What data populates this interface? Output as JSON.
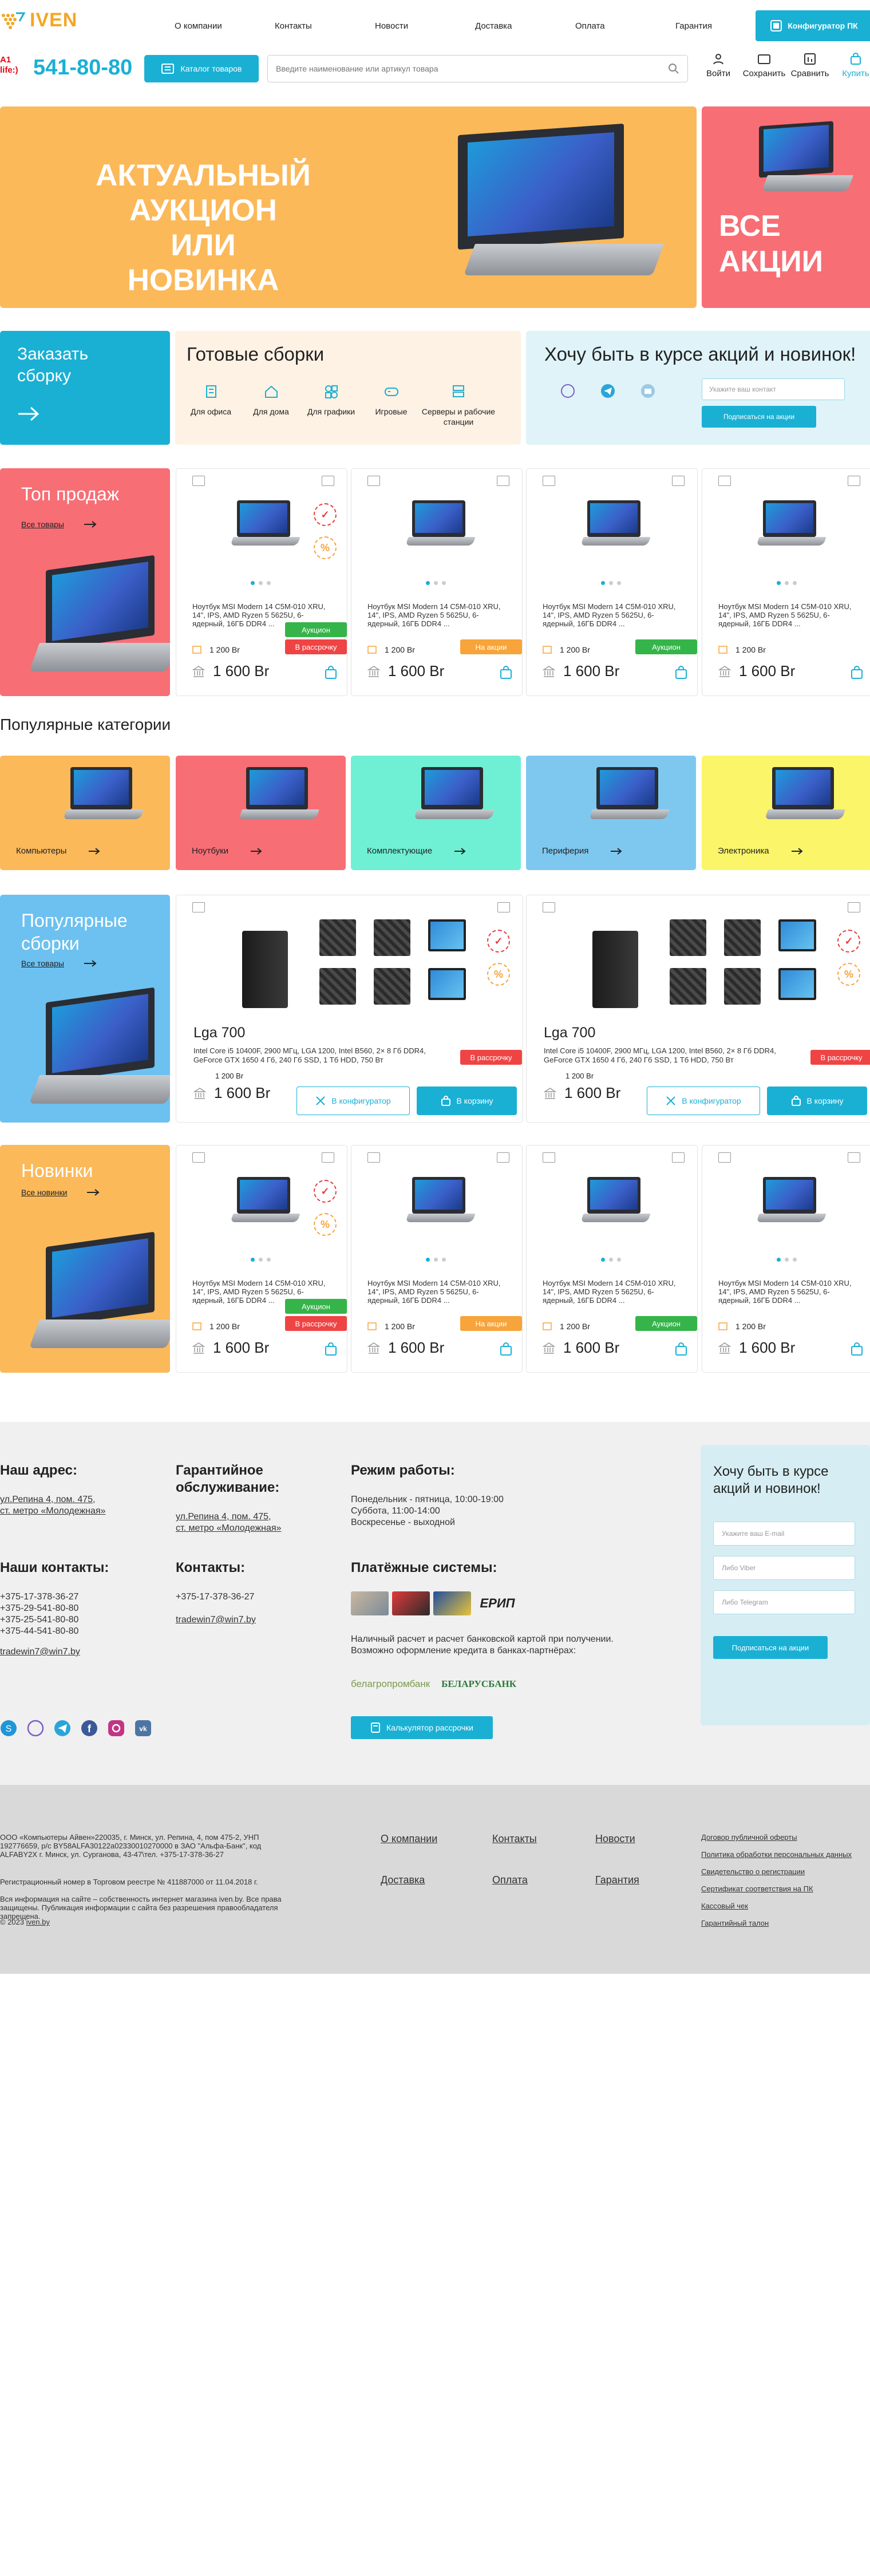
{
  "header": {
    "logo_text": "IVEN",
    "nav": [
      "О компании",
      "Контакты",
      "Новости",
      "Доставка",
      "Оплата",
      "Гарантия"
    ],
    "configurator_label": "Конфигуратор ПК",
    "phone_logo": "A1 life:)",
    "phone": "541-80-80",
    "catalog_label": "Каталог товаров",
    "search_placeholder": "Введите наименование или артикул товара",
    "icons": {
      "login": "Войти",
      "save": "Сохранить",
      "compare": "Сравнить",
      "buy": "Купить"
    }
  },
  "banner": {
    "main_lines": [
      "АКТУАЛЬНЫЙ АУКЦИОН",
      "ИЛИ",
      "НОВИНКА"
    ],
    "side_lines": [
      "ВСЕ",
      "АКЦИИ"
    ]
  },
  "order": {
    "title_lines": [
      "Заказать",
      "сборку"
    ]
  },
  "ready": {
    "title": "Готовые сборки",
    "items": [
      "Для офиса",
      "Для дома",
      "Для графики",
      "Игровые",
      "Серверы и рабочие станции"
    ]
  },
  "subscribe": {
    "title": "Хочу быть в курсе акций и новинок!",
    "placeholder": "Укажите ваш контакт",
    "button": "Подписаться на акции"
  },
  "top_sales": {
    "title": "Топ продаж",
    "link": "Все товары",
    "desc": "Ноутбук MSI Modern 14 C5M-010 XRU, 14\", IPS, AMD Ryzen 5 5625U, 6-ядерный, 16ГБ DDR4 ...",
    "products": [
      {
        "badges": [
          "Аукцион",
          "В рассрочку"
        ],
        "old": "1 200 Br",
        "price": "1 600 Br"
      },
      {
        "badges": [
          "На акции"
        ],
        "old": "1 200 Br",
        "price": "1 600 Br"
      },
      {
        "badges": [
          "Аукцион"
        ],
        "old": "1 200 Br",
        "price": "1 600 Br"
      },
      {
        "badges": [],
        "old": "1 200 Br",
        "price": "1 600 Br"
      }
    ]
  },
  "popular_categories": {
    "title": "Популярные категории",
    "items": [
      "Компьютеры",
      "Ноутбуки",
      "Комплектующие",
      "Периферия",
      "Электроника"
    ]
  },
  "popular_builds": {
    "title_lines": [
      "Популярные",
      "сборки"
    ],
    "link": "Все товары",
    "builds": [
      {
        "name": "Lga 700",
        "desc": "Intel Core i5 10400F, 2900 МГц, LGA 1200, Intel B560, 2× 8 Гб DDR4, GeForce GTX 1650 4 Гб, 240 Гб SSD, 1 Тб HDD, 750 Вт",
        "badge": "В рассрочку",
        "old": "1 200 Br",
        "price": "1 600 Br",
        "cfg": "В конфигуратор",
        "cart": "В корзину"
      },
      {
        "name": "Lga 700",
        "desc": "Intel Core i5 10400F, 2900 МГц, LGA 1200, Intel B560, 2× 8 Гб DDR4, GeForce GTX 1650 4 Гб, 240 Гб SSD, 1 Тб HDD, 750 Вт",
        "badge": "В рассрочку",
        "old": "1 200 Br",
        "price": "1 600 Br",
        "cfg": "В конфигуратор",
        "cart": "В корзину"
      }
    ]
  },
  "news": {
    "title": "Новинки",
    "link": "Все новинки",
    "desc": "Ноутбук MSI Modern 14 C5M-010 XRU, 14\", IPS, AMD Ryzen 5 5625U, 6-ядерный, 16ГБ DDR4 ...",
    "products": [
      {
        "badges": [
          "Аукцион",
          "В рассрочку"
        ],
        "old": "1 200 Br",
        "price": "1 600 Br"
      },
      {
        "badges": [
          "На акции"
        ],
        "old": "1 200 Br",
        "price": "1 600 Br"
      },
      {
        "badges": [
          "Аукцион"
        ],
        "old": "1 200 Br",
        "price": "1 600 Br"
      },
      {
        "badges": [],
        "old": "1 200 Br",
        "price": "1 600 Br"
      }
    ]
  },
  "footer": {
    "address_title": "Наш адрес:",
    "address": [
      "ул.Репина 4, пом. 475,",
      "ст. метро «Молодежная»"
    ],
    "warranty_title": "Гарантийное обслуживание:",
    "warranty": [
      "ул.Репина 4, пом. 475,",
      "ст. метро «Молодежная»"
    ],
    "hours_title": "Режим работы:",
    "hours": [
      "Понедельник - пятница, 10:00-19:00",
      "Суббота, 11:00-14:00",
      "Воскресенье - выходной"
    ],
    "contacts_title": "Наши контакты:",
    "phones": [
      "+375-17-378-36-27",
      "+375-29-541-80-80",
      "+375-25-541-80-80",
      "+375-44-541-80-80"
    ],
    "email": "tradewin7@win7.by",
    "contacts2_title": "Контакты:",
    "phone2": "+375-17-378-36-27",
    "email2": "tradewin7@win7.by",
    "payments_title": "Платёжные системы:",
    "payments_note": "Наличный расчет и расчет банковской картой при получении. Возможно оформление кредита в банках-партнёрах:",
    "bank1": "белагропромбанк",
    "bank2": "БЕЛАРУСБАНК",
    "erip": "ЕРИП",
    "calc_btn": "Калькулятор рассрочки",
    "sub_title": "Хочу быть в курсе акций и новинок!",
    "sub_inputs": [
      "Укажите ваш E-mail",
      "Либо Viber",
      "Либо Telegram"
    ],
    "sub_btn": "Подписаться на акции"
  },
  "bottom": {
    "legal": "ООО «Компьютеры Айвен»220035, г. Минск, ул. Репина, 4, пом 475-2, УНП 192776659, р/с BY58ALFA30122a02330010270000 в ЗАО \"Альфа-Банк\", код ALFABY2X г. Минск, ул. Сурганова, 43-47\\тел. +375-17-378-36-27",
    "register": "Регистрационный номер в Торговом реестре № 411887000 от 11.04.2018 г.",
    "rights": "Вся информация на сайте – собственность интернет магазина iven.by. Все права защищены. Публикация информации с сайта без разрешения правообладателя запрещена.",
    "copyright": "© 2023",
    "copyright_link": "iven.by",
    "links": [
      "О компании",
      "Контакты",
      "Новости",
      "Доставка",
      "Оплата",
      "Гарантия"
    ],
    "docs": [
      "Договор публичной оферты",
      "Политика обработки персональных данных",
      "Свидетельство о регистрации",
      "Сертификат соответствия на ПК",
      "Кассовый чек",
      "Гарантийный талон"
    ]
  },
  "colors": {
    "accent": "#1ab0d4",
    "orange": "#fbb95a",
    "pink": "#f76e75",
    "mint": "#6ff0d4",
    "sky": "#7ec8f0",
    "yellow": "#fbf56a",
    "green": "#35b44a",
    "red": "#ef4444",
    "amber": "#f7a43b"
  }
}
